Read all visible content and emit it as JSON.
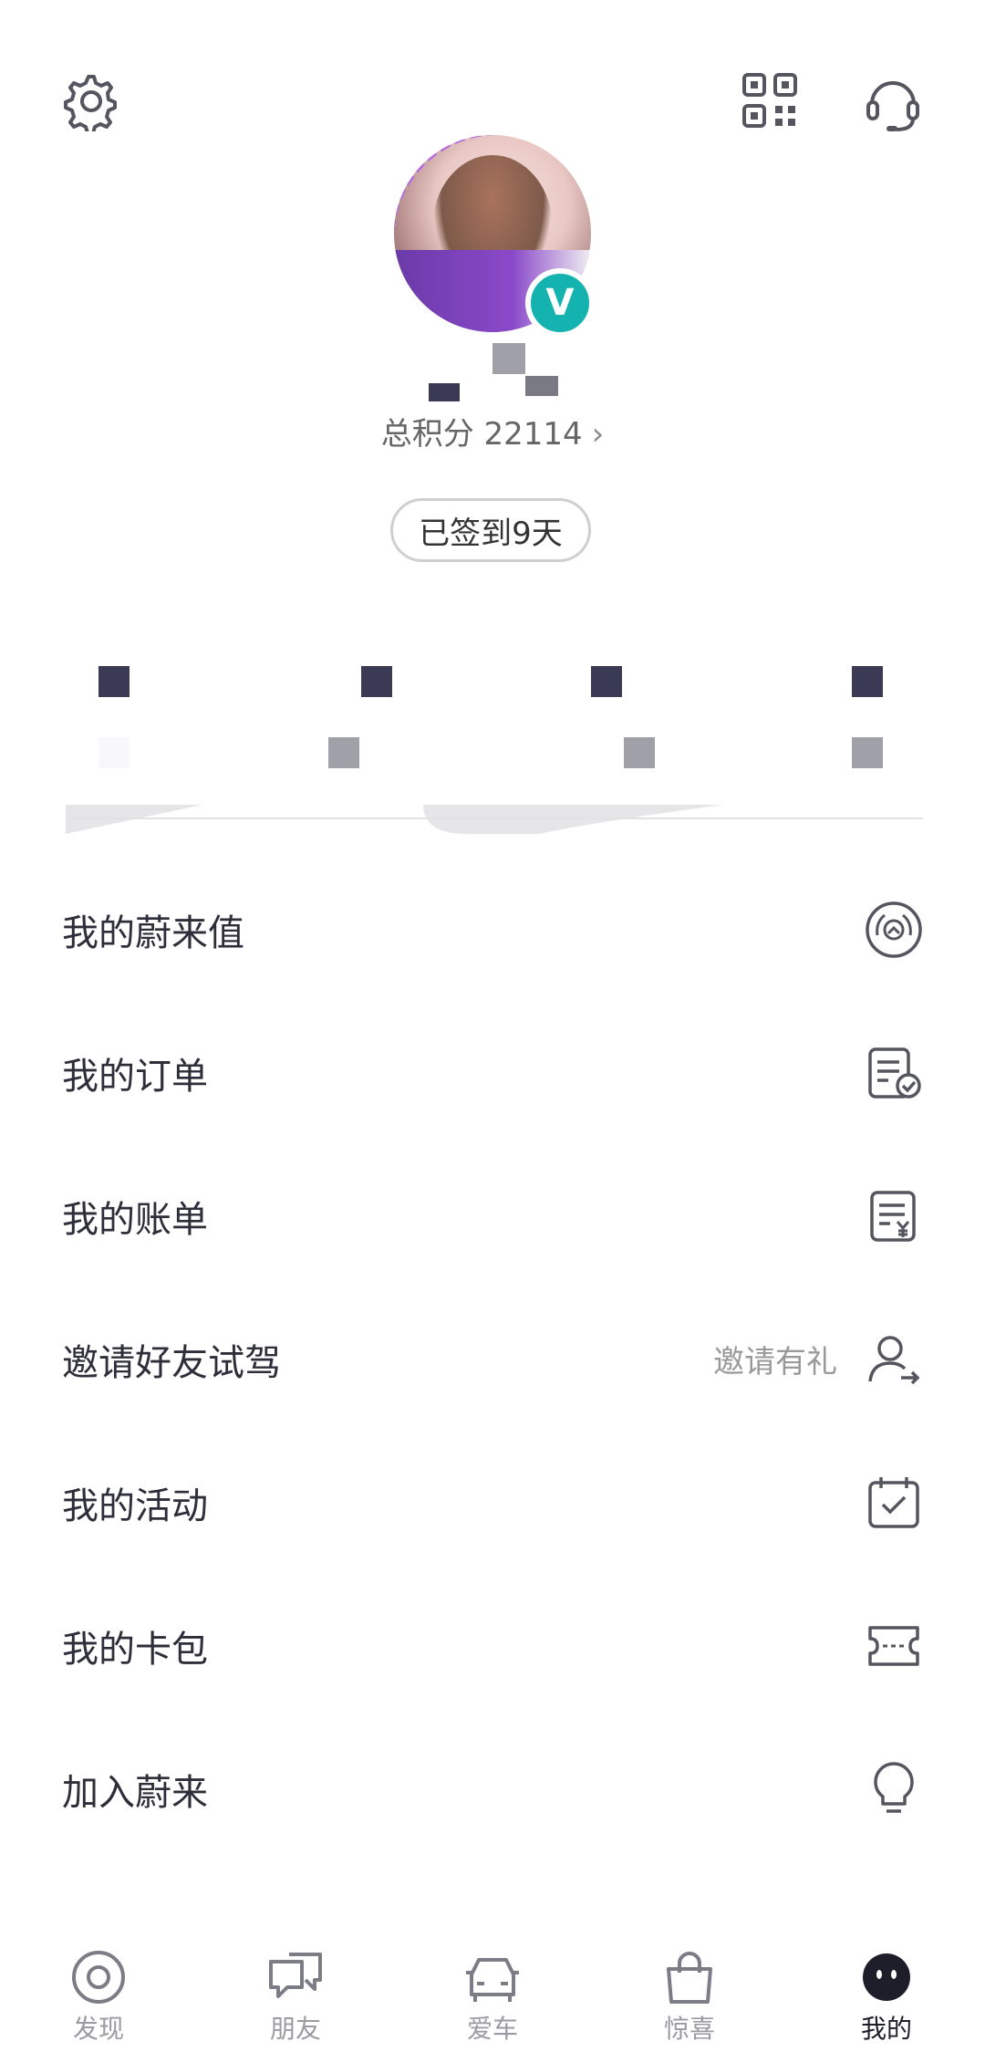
{
  "header": {
    "settings_icon": "gear-icon",
    "qr_icon": "qr-code-icon",
    "service_icon": "headset-icon"
  },
  "profile": {
    "verified_badge": "V",
    "points_label": "总积分 22114",
    "points_chevron": "›",
    "checkin_label": "已签到9天"
  },
  "menu": {
    "items": [
      {
        "label": "我的蔚来值",
        "hint": "",
        "icon": "nio-value-icon"
      },
      {
        "label": "我的订单",
        "hint": "",
        "icon": "order-icon"
      },
      {
        "label": "我的账单",
        "hint": "",
        "icon": "bill-icon"
      },
      {
        "label": "邀请好友试驾",
        "hint": "邀请有礼",
        "icon": "invite-user-icon"
      },
      {
        "label": "我的活动",
        "hint": "",
        "icon": "activity-icon"
      },
      {
        "label": "我的卡包",
        "hint": "",
        "icon": "card-wallet-icon"
      },
      {
        "label": "加入蔚来",
        "hint": "",
        "icon": "lightbulb-icon"
      }
    ]
  },
  "bottom_nav": {
    "items": [
      {
        "label": "发现",
        "icon": "discover-icon",
        "active": false
      },
      {
        "label": "朋友",
        "icon": "chat-icon",
        "active": false
      },
      {
        "label": "爱车",
        "icon": "car-icon",
        "active": false
      },
      {
        "label": "惊喜",
        "icon": "shopping-bag-icon",
        "active": false
      },
      {
        "label": "我的",
        "icon": "me-icon",
        "active": true
      }
    ]
  },
  "colors": {
    "accent": "#14b3b0",
    "text_primary": "#2e2e3a",
    "text_secondary": "#999999"
  }
}
